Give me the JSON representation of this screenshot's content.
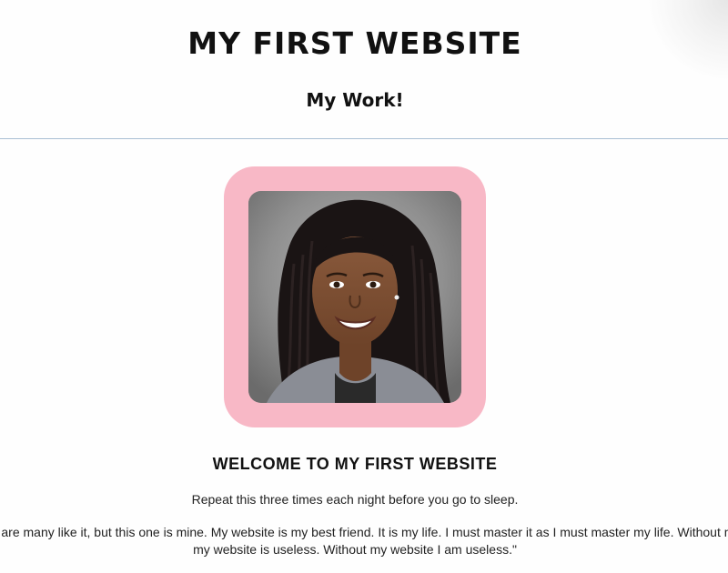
{
  "header": {
    "site_title": "MY FIRST WEBSITE",
    "subtitle": "My Work!"
  },
  "profile": {
    "frame_color": "#f8b8c6"
  },
  "main": {
    "welcome_heading": "WELCOME TO MY FIRST WEBSITE",
    "intro_text": "Repeat this three times each night before you go to sleep.",
    "creed_text": "There are many like it, but this one is mine. My website is my best friend. It is my life. I must master it as I must master my life. Without me, my website is useless. Without my website I am useless.\""
  }
}
